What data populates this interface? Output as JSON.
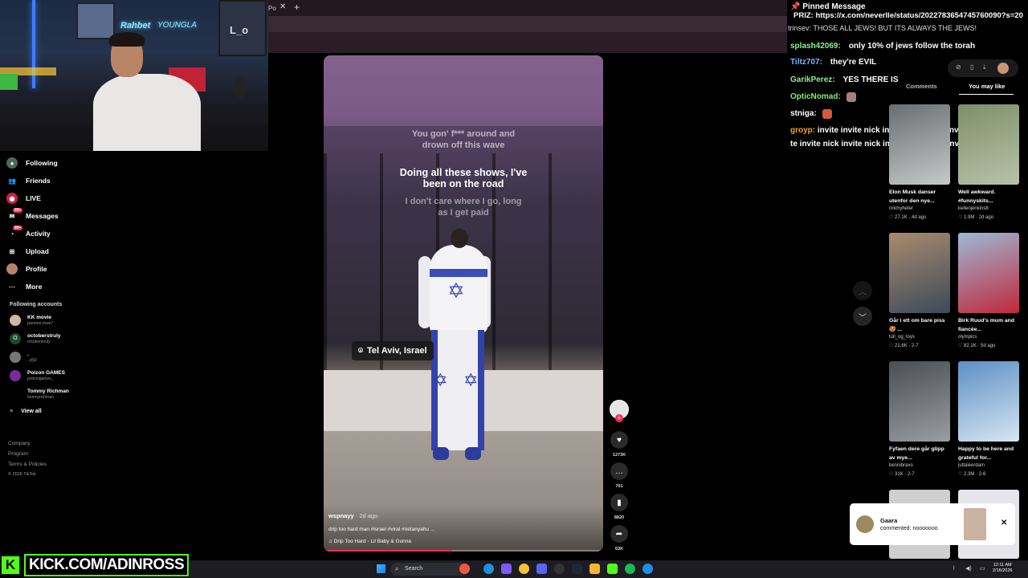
{
  "browser": {
    "tab_label": "Po",
    "tab_close": "✕",
    "new_tab": "+"
  },
  "webcam": {
    "neon_left": "Rahbet",
    "neon_right": "YOUNGLA",
    "sign": "L_o"
  },
  "nav": {
    "items": [
      {
        "label": "Following",
        "icon": "following-avatar-icon"
      },
      {
        "label": "Friends",
        "icon": "friends-icon"
      },
      {
        "label": "LIVE",
        "icon": "live-icon"
      },
      {
        "label": "Messages",
        "icon": "messages-icon",
        "badge": "99+"
      },
      {
        "label": "Activity",
        "icon": "activity-icon",
        "badge": "99+"
      },
      {
        "label": "Upload",
        "icon": "upload-icon"
      },
      {
        "label": "Profile",
        "icon": "profile-avatar-icon"
      },
      {
        "label": "More",
        "icon": "more-icon"
      }
    ],
    "following_header": "Following accounts",
    "accounts": [
      {
        "name": "KK movie",
        "handle": "jasmine.rowe7"
      },
      {
        "name": "octoberstruly",
        "handle": "octoberstruly"
      },
      {
        "name": ".",
        "handle": "..yfji3"
      },
      {
        "name": "Poizon GAMES",
        "handle": "poizongames_"
      },
      {
        "name": "Tommy Richman",
        "handle": "tommyrichman"
      }
    ],
    "view_all": "View all",
    "footer": [
      "Company",
      "Program",
      "Terms & Policies"
    ],
    "copyright": "© 2026 TikTok"
  },
  "video": {
    "lyrics": [
      "You gon' f*** around and drown off this wave",
      "Doing all these shows, I've been on the road",
      "I don't care where I go, long as I get paid"
    ],
    "location": "Tel Aviv, Israel",
    "username": "wspnayy",
    "posted": "· 2d ago",
    "caption": "drip too hard man #israel #viral #netanyahu ...",
    "music": "♫  Drip Too Hard - Lil Baby & Gunna",
    "progress": 0.46
  },
  "actions": {
    "likes": "1273K",
    "comments": "761",
    "saves": "8820",
    "shares": "63K"
  },
  "chat": {
    "pinned_title": "Pinned Message",
    "pinned_body": "PRIZ: https://x.com/neverlle/status/2022783654745760090?s=20",
    "cut_line": "trinsev:  THOSE ALL JEWS! BUT ITS ALWAYS THE JEWS!",
    "messages": [
      {
        "name": "splash42069:",
        "color": "#8df08d",
        "text": "only 10% of jews follow the torah"
      },
      {
        "name": "Tiltz707:",
        "color": "#7ab3ff",
        "text": "they're EVIL"
      },
      {
        "name": "GarikPerez:",
        "color": "#8df08d",
        "text": "YES THERE IS"
      },
      {
        "name": "OpticNomad:",
        "color": "#7ef26a",
        "text": ""
      },
      {
        "name": "stniga:",
        "color": "#ffffff",
        "text": ""
      }
    ],
    "spam_name": "groyp:",
    "spam_line1": "invite invite nick  invite nick  invite invite nick  invite",
    "spam_line2": "te invite nick  invite nick  invite invite nick  invite nick"
  },
  "right_panel": {
    "tabs": [
      "Comments",
      "You may like"
    ],
    "cards": [
      {
        "title": "Elon Musk danser utenfor den nye...",
        "author": "nrkmyheter",
        "stats": "♡ 27.1K · 4d ago",
        "colors": [
          "#6a6e70",
          "#c7c9c9"
        ]
      },
      {
        "title": "Well awkward. #funnyskits...",
        "author": "kellenjenkins8",
        "stats": "♡ 1.9M · 2d ago",
        "colors": [
          "#7d8f6a",
          "#b9c2a8"
        ]
      },
      {
        "title": "Går i ett om bare piss🥵 ...",
        "author": "tull_og_toys",
        "stats": "♡ 21.6K · 2-7",
        "colors": [
          "#a98b6e",
          "#3c4a5a"
        ]
      },
      {
        "title": "Birk Ruud's mum and fiancée...",
        "author": "olympics",
        "stats": "♡ 82.1K · 5d ago",
        "colors": [
          "#9db9d6",
          "#c0283c"
        ]
      },
      {
        "title": "Fyfaen dere går glipp av mye...",
        "author": "bennibravo",
        "stats": "♡ 31K · 2-7",
        "colors": [
          "#4a4e52",
          "#9a9ea2"
        ]
      },
      {
        "title": "Happy to be here and grateful for...",
        "author": "juttaleerdam",
        "stats": "♡ 2.3M · 2-6",
        "colors": [
          "#5d8fc4",
          "#d6e6f2"
        ]
      }
    ]
  },
  "notification": {
    "name": "Gaara",
    "text": "commented: nooooooo",
    "close": "✕"
  },
  "kick": {
    "logo": "K",
    "text": "KICK.COM/ADINROSS"
  },
  "taskbar": {
    "search": "Search",
    "time": "12:11 AM",
    "date": "2/16/2026"
  }
}
